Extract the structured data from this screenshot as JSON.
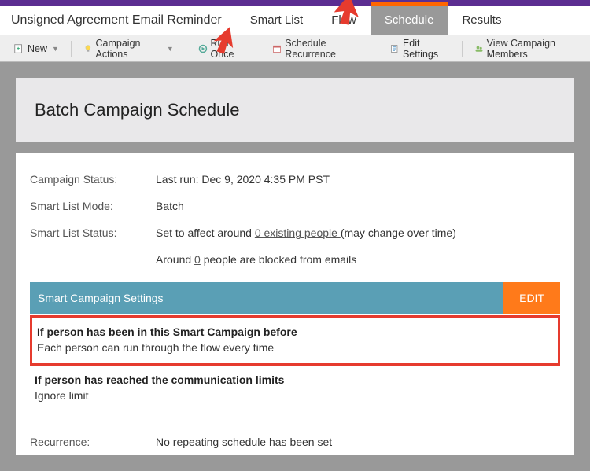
{
  "header": {
    "title": "Unsigned Agreement Email Reminder",
    "tabs": [
      "Smart List",
      "Flow",
      "Schedule",
      "Results"
    ],
    "activeTab": "Schedule"
  },
  "toolbar": {
    "new": "New",
    "campaign_actions": "Campaign Actions",
    "run_once": "Run Once",
    "schedule_recurrence": "Schedule Recurrence",
    "edit_settings": "Edit Settings",
    "view_members": "View Campaign Members"
  },
  "page": {
    "title": "Batch Campaign Schedule"
  },
  "status": {
    "campaign_status_label": "Campaign Status:",
    "campaign_status_value": "Last run: Dec 9, 2020 4:35 PM PST",
    "smart_list_mode_label": "Smart List Mode:",
    "smart_list_mode_value": "Batch",
    "smart_list_status_label": "Smart List Status:",
    "smart_list_status_prefix": "Set to affect around ",
    "smart_list_status_link": "0 existing people ",
    "smart_list_status_suffix": "(may change over time)",
    "blocked_prefix": "Around ",
    "blocked_link": "0",
    "blocked_suffix": " people are blocked from emails"
  },
  "settings": {
    "header": "Smart Campaign Settings",
    "edit": "EDIT",
    "rule1_hd": "If person has been in this Smart Campaign before",
    "rule1_bd": "Each person can run through the flow every time",
    "rule2_hd": "If person has reached the communication limits",
    "rule2_bd": "Ignore limit"
  },
  "recurrence": {
    "label": "Recurrence:",
    "value": "No repeating schedule has been set"
  }
}
